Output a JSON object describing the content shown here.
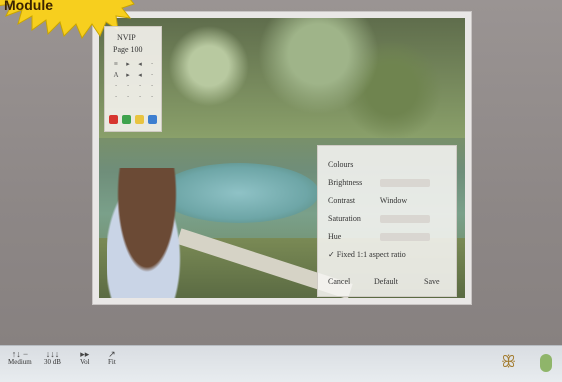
{
  "sticker": {
    "text": "Module",
    "fill": "#f7cf1e",
    "stroke": "#c9a500"
  },
  "palette": {
    "title": "NVIP",
    "page": "Page 100",
    "grid": [
      "≡",
      "▸",
      "◂",
      "·",
      "A",
      "▸",
      "◂",
      "·",
      "·",
      "·",
      "·",
      "·",
      "·",
      "·",
      "·",
      "·",
      "·",
      "·",
      "·",
      "·"
    ],
    "swatches": [
      "#d7362f",
      "#3fa34d",
      "#e9c440",
      "#3e7fd0"
    ]
  },
  "panel": {
    "title": "Colours",
    "rows": [
      {
        "label": "Brightness"
      },
      {
        "label": "Contrast",
        "value": "Window"
      },
      {
        "label": "Saturation"
      },
      {
        "label": "Hue"
      }
    ],
    "checkbox": "✓ Fixed 1:1 aspect ratio",
    "cancel": "Cancel",
    "default": "Default",
    "save": "Save"
  },
  "taskbar": {
    "items": [
      {
        "label": "Medium",
        "sub": "↑↓ −"
      },
      {
        "label": "30 dB",
        "sub": "↓↓↓"
      },
      {
        "label": "Vol",
        "sub": "▸▸"
      },
      {
        "label": "Fit",
        "sub": "↗"
      }
    ],
    "right_icon": "footprint-icon",
    "right_icon2": "leaf-icon"
  }
}
